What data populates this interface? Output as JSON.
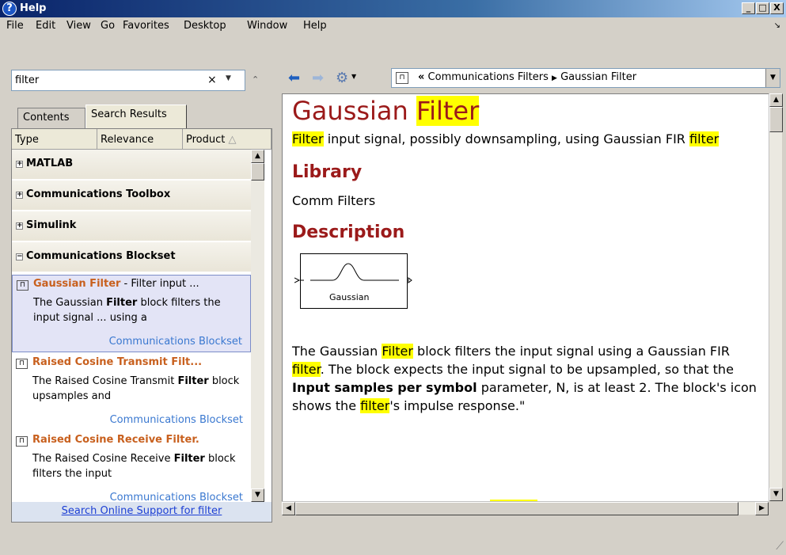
{
  "window": {
    "title": "Help",
    "min": "_",
    "max": "□",
    "close": "X"
  },
  "menu": [
    "File",
    "Edit",
    "View",
    "Go",
    "Favorites",
    "Desktop",
    "Window",
    "Help"
  ],
  "search": {
    "value": "filter",
    "clear": "×",
    "dropdown": "▼",
    "collapse": "⌃"
  },
  "tabs": [
    "Contents",
    "Search Results"
  ],
  "columns": [
    "Type",
    "Relevance",
    "Product"
  ],
  "groups": [
    {
      "label": "MATLAB",
      "expander": "+"
    },
    {
      "label": "Communications Toolbox",
      "expander": "+"
    },
    {
      "label": "Simulink",
      "expander": "+"
    },
    {
      "label": "Communications Blockset",
      "expander": "−"
    }
  ],
  "results": [
    {
      "title": "Gaussian Filter",
      "suffix": " - Filter input ...",
      "desc_pre": "The Gaussian ",
      "desc_bold": "Filter",
      "desc_post": " block filters the input signal ... using a",
      "product": "Communications Blockset"
    },
    {
      "title": "Raised Cosine Transmit Filt...",
      "suffix": "",
      "desc_pre": "The Raised Cosine Transmit ",
      "desc_bold": "Filter",
      "desc_post": " block upsamples and",
      "product": "Communications Blockset"
    },
    {
      "title": "Raised Cosine Receive Filter.",
      "suffix": "",
      "desc_pre": "The Raised Cosine Receive ",
      "desc_bold": "Filter",
      "desc_post": " block filters the input",
      "product": "Communications Blockset"
    }
  ],
  "search_online": "Search Online Support for filter",
  "breadcrumb": {
    "sep": "«",
    "parent": "Communications Filters",
    "arrow": "▶",
    "current": "Gaussian Filter"
  },
  "page": {
    "title_plain": "Gaussian ",
    "title_hl": "Filter",
    "subtitle_hl1": "Filter",
    "subtitle_mid": " input signal, possibly downsampling, using Gaussian FIR ",
    "subtitle_hl2": "filter",
    "library_heading": "Library",
    "library_value": "Comm Filters",
    "description_heading": "Description",
    "block_label": "Gaussian",
    "d1": "The Gaussian ",
    "d1h": "Filter",
    "d2": " block filters the input signal using a Gaussian FIR ",
    "d2h": "filter",
    "d3": ". The block expects the input signal to be upsampled, so that the ",
    "d3b": "Input samples per symbol",
    "d4": " parameter, N, is at least 2. The block's icon shows the ",
    "d4h": "filter",
    "d5": "'s impulse response.\""
  }
}
